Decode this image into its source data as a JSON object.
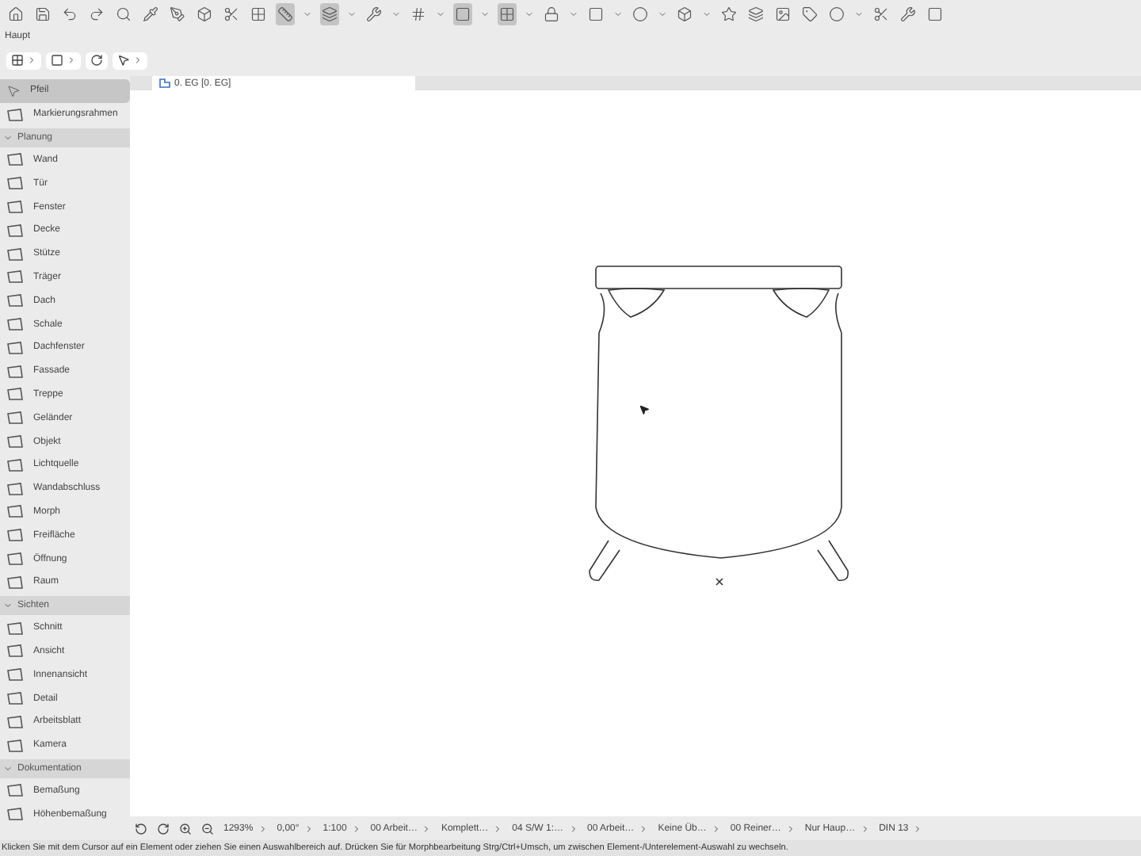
{
  "toolbar_label": "Haupt",
  "view_tab": {
    "label": "0. EG [0. EG]",
    "selected": true
  },
  "toolbox": {
    "sections": [
      {
        "items": [
          {
            "label": "Pfeil",
            "selected": true
          },
          {
            "label": "Markierungsrahmen",
            "selected": false
          }
        ]
      },
      {
        "title": "Planung",
        "expanded": true,
        "items": [
          {
            "label": "Wand",
            "selected": false
          },
          {
            "label": "Tür",
            "selected": false
          },
          {
            "label": "Fenster",
            "selected": false
          },
          {
            "label": "Decke",
            "selected": false
          },
          {
            "label": "Stütze",
            "selected": false
          },
          {
            "label": "Träger",
            "selected": false
          },
          {
            "label": "Dach",
            "selected": false
          },
          {
            "label": "Schale",
            "selected": false
          },
          {
            "label": "Dachfenster",
            "selected": false
          },
          {
            "label": "Fassade",
            "selected": false
          },
          {
            "label": "Treppe",
            "selected": false
          },
          {
            "label": "Geländer",
            "selected": false
          },
          {
            "label": "Objekt",
            "selected": false
          },
          {
            "label": "Lichtquelle",
            "selected": false
          },
          {
            "label": "Wandabschluss",
            "selected": false
          },
          {
            "label": "Morph",
            "selected": false
          },
          {
            "label": "Freifläche",
            "selected": false
          },
          {
            "label": "Öffnung",
            "selected": false
          },
          {
            "label": "Raum",
            "selected": false
          }
        ]
      },
      {
        "title": "Sichten",
        "expanded": true,
        "items": [
          {
            "label": "Schnitt",
            "selected": false
          },
          {
            "label": "Ansicht",
            "selected": false
          },
          {
            "label": "Innenansicht",
            "selected": false
          },
          {
            "label": "Detail",
            "selected": false
          },
          {
            "label": "Arbeitsblatt",
            "selected": false
          },
          {
            "label": "Kamera",
            "selected": false
          }
        ]
      },
      {
        "title": "Dokumentation",
        "expanded": true,
        "items": [
          {
            "label": "Bemaßung",
            "selected": false
          },
          {
            "label": "Höhenbemaßung",
            "selected": false
          }
        ]
      }
    ]
  },
  "status_bar": {
    "zoom": "1293%",
    "angle": "0,00°",
    "fields": [
      "1:100",
      "00 Arbeit…",
      "Komplett…",
      "04 S/W 1:…",
      "00 Arbeit…",
      "Keine Üb…",
      "00 Reiner…",
      "Nur Haup…",
      "DIN 13"
    ]
  },
  "message": "Klicken Sie mit dem Cursor auf ein Element oder ziehen Sie einen Auswahlbereich auf. Drücken Sie für Morphbearbeitung Strg/Ctrl+Umsch, um zwischen Element-/Unterelement-Auswahl zu wechseln."
}
